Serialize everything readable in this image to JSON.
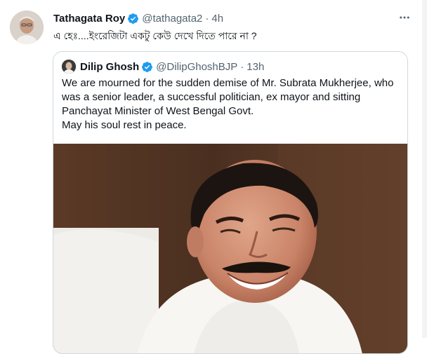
{
  "tweet": {
    "author_name": "Tathagata Roy",
    "handle": "@tathagata2",
    "separator": "·",
    "time": "4h",
    "more_icon": "ellipsis-icon",
    "text": "এ হেঃ....ইংরেজিটা একটু কেউ দেখে দিতে পারে না ?"
  },
  "quoted_tweet": {
    "author_name": "Dilip Ghosh",
    "handle": "@DilipGhoshBJP",
    "separator": "·",
    "time": "13h",
    "text_lines": [
      "We are mourned for the sudden  demise of Mr. Subrata Mukherjee, who",
      "was a senior leader, a successful politician, ex mayor and sitting",
      "Panchayat Minister of West Bengal Govt.",
      "May his soul rest in peace."
    ]
  },
  "colors": {
    "verified_blue": "#1d9bf0",
    "text_primary": "#0f1419",
    "text_secondary": "#536471",
    "border": "#cfd9de"
  }
}
